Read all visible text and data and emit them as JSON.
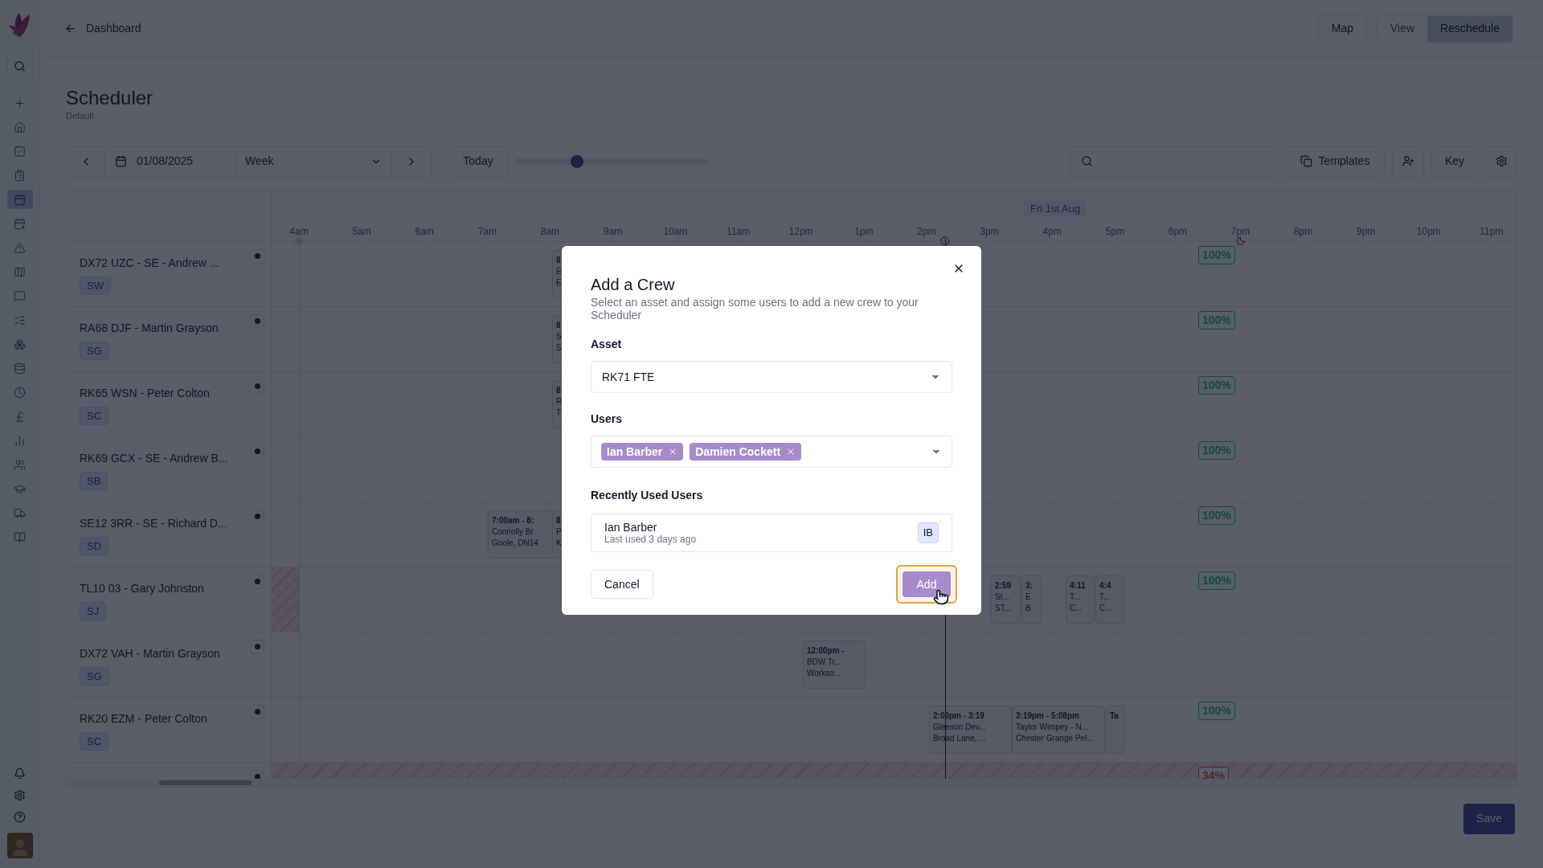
{
  "nav": {
    "items": [
      {
        "selected": false
      },
      {
        "selected": false
      },
      {
        "selected": false
      },
      {
        "selected": false
      },
      {
        "selected": true
      },
      {
        "selected": false
      },
      {
        "selected": false
      },
      {
        "selected": false
      },
      {
        "selected": false
      },
      {
        "selected": false
      },
      {
        "selected": false
      },
      {
        "selected": false
      },
      {
        "selected": false
      },
      {
        "selected": false
      },
      {
        "selected": false
      },
      {
        "selected": false
      },
      {
        "selected": false
      },
      {
        "selected": false
      },
      {
        "selected": false
      }
    ]
  },
  "topbar": {
    "back_link": "Dashboard",
    "map_button": "Map",
    "view_modes": [
      {
        "label": "View",
        "selected": false
      },
      {
        "label": "Reschedule",
        "selected": true
      }
    ]
  },
  "page": {
    "title": "Scheduler",
    "subtitle": "Default"
  },
  "toolbar": {
    "date": "01/08/2025",
    "period": "Week",
    "today_button": "Today",
    "zoom": {
      "level": 0.32
    },
    "templates_button": "Templates",
    "key_button": "Key"
  },
  "timeline": {
    "day_label": "Fri 1st Aug",
    "hours": [
      "4am",
      "5am",
      "6am",
      "7am",
      "8am",
      "9am",
      "10am",
      "11am",
      "12pm",
      "1pm",
      "2pm",
      "3pm",
      "4pm",
      "5pm",
      "6pm",
      "7pm",
      "8pm",
      "9pm",
      "10pm",
      "11pm"
    ]
  },
  "crews": [
    {
      "name": "DX72 UZC - SE - Andrew ...",
      "initials": "SW",
      "utilisation": {
        "text": "100%",
        "low": false
      },
      "events": [
        {
          "lines": [
            "8",
            "E",
            "E"
          ]
        }
      ]
    },
    {
      "name": "RA68 DJF - Martin Grayson",
      "initials": "SG",
      "utilisation": {
        "text": "100%",
        "low": false
      },
      "events": [
        {
          "lines": [
            "8",
            "S",
            "S"
          ]
        }
      ]
    },
    {
      "name": "RK65 WSN - Peter Colton",
      "initials": "SC",
      "utilisation": {
        "text": "100%",
        "low": false
      },
      "events": [
        {
          "lines": [
            "8",
            "R",
            "T"
          ]
        }
      ]
    },
    {
      "name": "RK69 GCX - SE - Andrew B...",
      "initials": "SB",
      "utilisation": {
        "text": "100%",
        "low": false
      }
    },
    {
      "name": "SE12 3RR - SE - Richard D...",
      "initials": "SD",
      "utilisation": {
        "text": "100%",
        "low": false
      },
      "events": [
        {
          "lines": [
            "7:00am - 8:",
            "Connolly Br",
            "Goole, DN14"
          ]
        },
        {
          "lines": [
            "8",
            "P",
            "K"
          ]
        }
      ]
    },
    {
      "name": "TL10 03 - Gary Johnston",
      "initials": "SJ",
      "early_unavailable": true,
      "utilisation": {
        "text": "100%",
        "low": false
      },
      "events": [
        {
          "lines": [
            "2:59",
            "St...",
            "ST..."
          ]
        },
        {
          "lines": [
            "3:",
            "E.",
            "B."
          ]
        },
        {
          "lines": [
            "4:11",
            "T...",
            "C..."
          ]
        },
        {
          "lines": [
            "4:4",
            "T...",
            "C..."
          ]
        }
      ]
    },
    {
      "name": "DX72 VAH - Martin Grayson",
      "initials": "SG",
      "events": [
        {
          "lines": [
            "12:00pm -",
            "BDW Tr...",
            "Workso..."
          ]
        }
      ]
    },
    {
      "name": "RK20 EZM - Peter Colton",
      "initials": "SC",
      "utilisation": {
        "text": "100%",
        "low": false
      },
      "events": [
        {
          "lines": [
            "2:00pm - 3:19",
            "Gleeson Dev...",
            "Broad Lane, ..."
          ]
        },
        {
          "lines": [
            "3:19pm - 5:08pm",
            "Taylor Wimpey - N...",
            "Chester Grange Pel..."
          ]
        },
        {
          "lines": [
            "Ta"
          ]
        }
      ]
    },
    {
      "unavailable": true,
      "utilisation": {
        "text": "34%",
        "low": true
      }
    }
  ],
  "save_button": "Save",
  "dialog": {
    "title": "Add a Crew",
    "description": "Select an asset and assign some users to add a new crew to your Scheduler",
    "asset": {
      "label": "Asset",
      "value": "RK71 FTE"
    },
    "users": {
      "label": "Users",
      "tags": [
        "Ian Barber",
        "Damien Cockett"
      ]
    },
    "recent": {
      "label": "Recently Used Users",
      "items": [
        {
          "name": "Ian Barber",
          "detail": "Last used 3 days ago",
          "initials": "IB"
        }
      ]
    },
    "cancel_button": "Cancel",
    "add_button": "Add"
  }
}
